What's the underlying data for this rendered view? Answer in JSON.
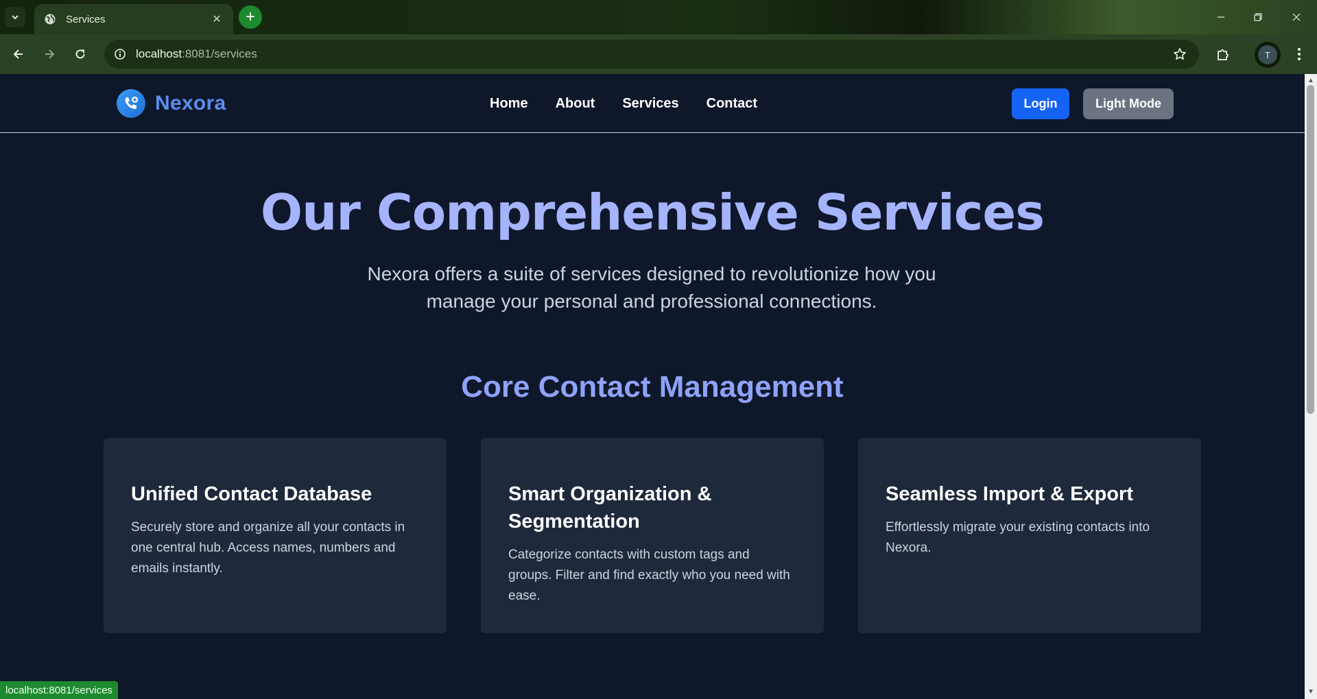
{
  "browser": {
    "tab_title": "Services",
    "url_host": "localhost",
    "url_rest": ":8081/services",
    "profile_initial": "T",
    "status_url": "localhost:8081/services"
  },
  "site": {
    "brand": "Nexora",
    "nav": [
      "Home",
      "About",
      "Services",
      "Contact"
    ],
    "login_label": "Login",
    "mode_label": "Light Mode"
  },
  "hero": {
    "title": "Our Comprehensive Services",
    "subtitle": "Nexora offers a suite of services designed to revolutionize how you manage your personal and professional connections."
  },
  "section": {
    "title": "Core Contact Management",
    "cards": [
      {
        "title": "Unified Contact Database",
        "text": "Securely store and organize all your contacts in one central hub. Access names, numbers and emails instantly."
      },
      {
        "title": "Smart Organization & Segmentation",
        "text": "Categorize contacts with custom tags and groups. Filter and find exactly who you need with ease."
      },
      {
        "title": "Seamless Import & Export",
        "text": "Effortlessly migrate your existing contacts into Nexora."
      }
    ]
  },
  "colors": {
    "page_bg": "#0f172a",
    "card_bg": "#1e293b",
    "accent_title": "#a5b4fc",
    "login_button": "#1563f5",
    "mode_button": "#6b7280",
    "brand": "#5b8ef0"
  }
}
